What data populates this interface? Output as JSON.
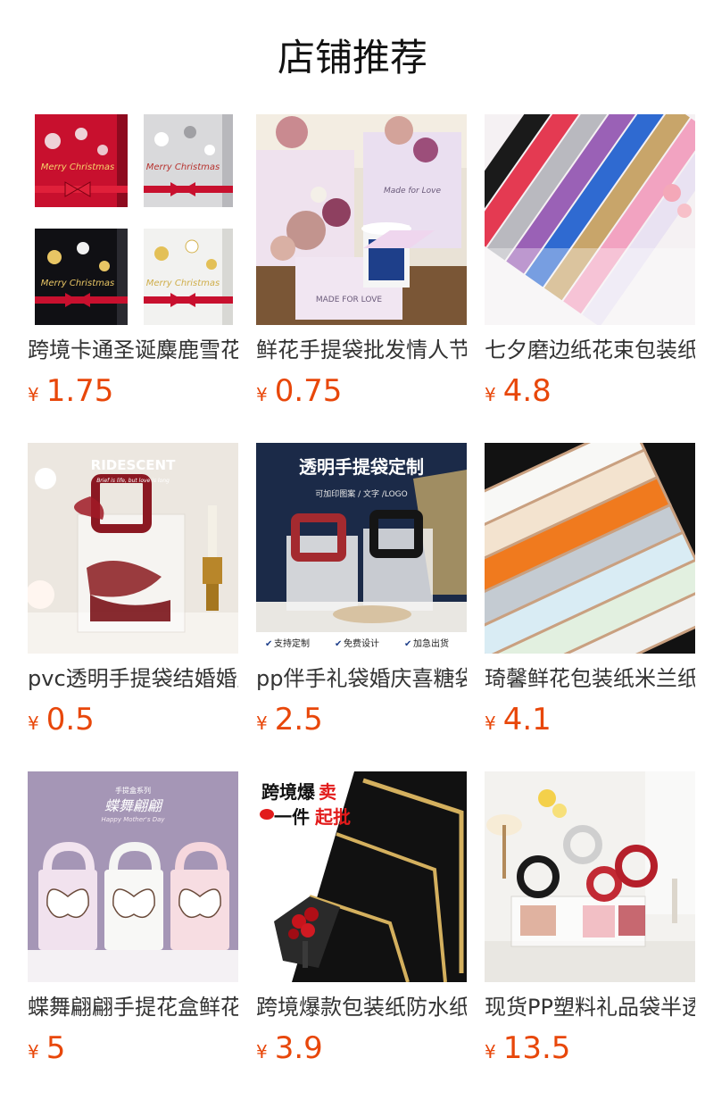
{
  "section": {
    "title": "店铺推荐"
  },
  "currency_symbol": "¥",
  "products": [
    {
      "name": "跨境卡通圣诞麋鹿雪花手提袋",
      "price": "1.75",
      "image": {
        "icon": "christmas-gift-bags-image",
        "text": [
          "Merry Christmas",
          "Merry Christmas",
          "Merry Christmas",
          "Merry Christmas"
        ]
      }
    },
    {
      "name": "鲜花手提袋批发情人节",
      "price": "0.75",
      "image": {
        "icon": "flower-box-bag-image",
        "text": [
          "Made for Love",
          "MADE FOR LOVE"
        ]
      }
    },
    {
      "name": "七夕磨边纸花束包装纸",
      "price": "4.8",
      "image": {
        "icon": "colored-wrapping-paper-rolls-image",
        "text": []
      }
    },
    {
      "name": "pvc透明手提袋结婚婚庆",
      "price": "0.5",
      "image": {
        "icon": "pvc-transparent-bag-image",
        "text": [
          "RIDESCENT",
          "Brief is life, but love is long"
        ]
      }
    },
    {
      "name": "pp伴手礼袋婚庆喜糖袋",
      "price": "2.5",
      "image": {
        "icon": "pp-handbag-customize-image",
        "text": [
          "透明手提袋定制",
          "可加印图案 / 文字 /LOGO",
          "支持定制",
          "免费设计",
          "加急出货"
        ]
      }
    },
    {
      "name": "琦馨鲜花包装纸米兰纸",
      "price": "4.1",
      "image": {
        "icon": "milan-wrapping-paper-image",
        "text": []
      }
    },
    {
      "name": "蝶舞翩翩手提花盒鲜花",
      "price": "5",
      "image": {
        "icon": "butterfly-flower-box-image",
        "text": [
          "手提盒系列",
          "蝶舞翩翩",
          "Happy Mother's Day"
        ]
      }
    },
    {
      "name": "跨境爆款包装纸防水纸",
      "price": "3.9",
      "image": {
        "icon": "black-gold-wrapping-paper-image",
        "text": [
          "跨境爆",
          "卖",
          "一件",
          "起批"
        ]
      }
    },
    {
      "name": "现货PP塑料礼品袋半透明",
      "price": "13.5",
      "image": {
        "icon": "pp-ring-handle-bag-image",
        "text": []
      }
    }
  ],
  "colors": {
    "price": "#e8470a",
    "title": "#111111",
    "name": "#333333"
  }
}
